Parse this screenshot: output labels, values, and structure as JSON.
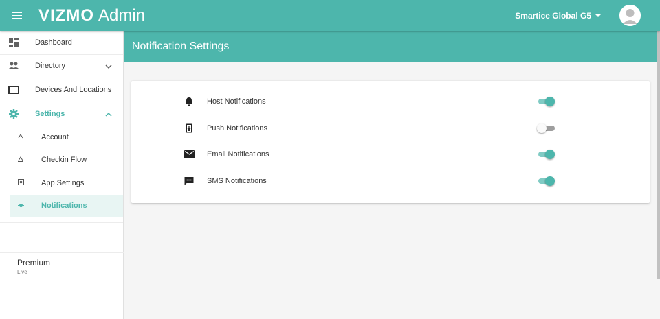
{
  "header": {
    "brand_bold": "VIZMO",
    "brand_light": "Admin",
    "account_name": "Smartice Global G5"
  },
  "sidebar": {
    "items": [
      {
        "label": "Dashboard",
        "icon": "dashboard-icon"
      },
      {
        "label": "Directory",
        "icon": "people-icon"
      },
      {
        "label": "Devices And Locations",
        "icon": "tablet-icon"
      },
      {
        "label": "Settings",
        "icon": "gear-icon"
      }
    ],
    "settings_sub": [
      {
        "label": "Account",
        "icon": "account-icon"
      },
      {
        "label": "Checkin Flow",
        "icon": "checkin-icon"
      },
      {
        "label": "App Settings",
        "icon": "app-settings-icon"
      },
      {
        "label": "Notifications",
        "icon": "notifications-icon"
      }
    ],
    "plan": {
      "title": "Premium",
      "status": "Live"
    }
  },
  "main": {
    "title": "Notification Settings",
    "settings": [
      {
        "label": "Host Notifications",
        "icon": "bell-icon",
        "enabled": true
      },
      {
        "label": "Push Notifications",
        "icon": "phone-download-icon",
        "enabled": false
      },
      {
        "label": "Email Notifications",
        "icon": "mail-icon",
        "enabled": true
      },
      {
        "label": "SMS Notifications",
        "icon": "chat-icon",
        "enabled": true
      }
    ]
  },
  "colors": {
    "accent": "#4db6ac",
    "accent_light": "#80cbc4",
    "active_bg": "#e8f5f3"
  }
}
